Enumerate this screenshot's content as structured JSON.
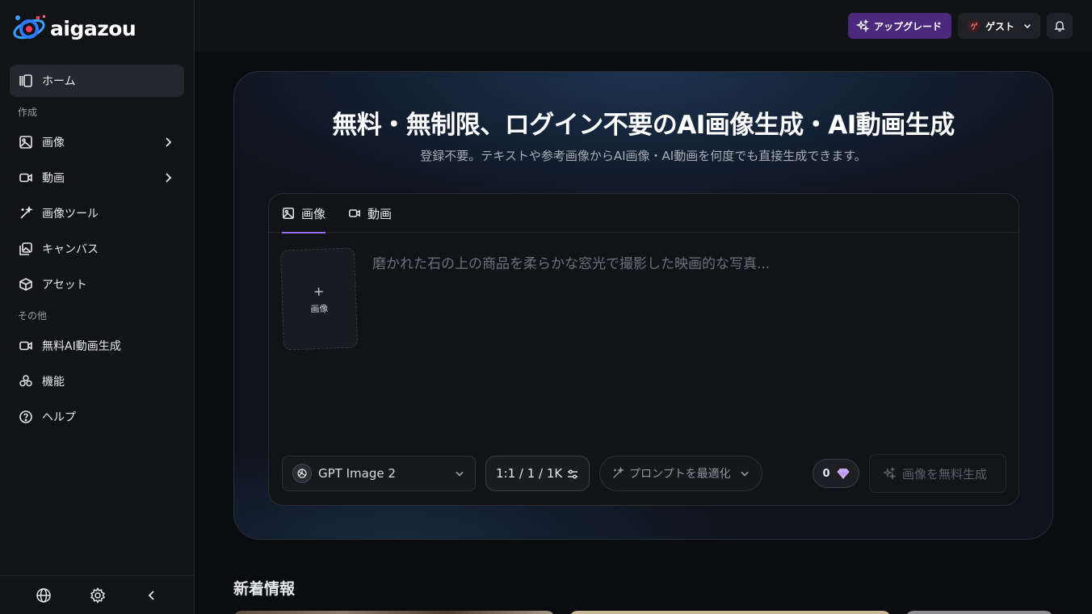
{
  "brand": {
    "name": "aigazou"
  },
  "sidebar": {
    "home": "ホーム",
    "section_create": "作成",
    "create_items": [
      {
        "label": "画像",
        "icon": "image-icon",
        "has_submenu": true
      },
      {
        "label": "動画",
        "icon": "video-icon",
        "has_submenu": true
      },
      {
        "label": "画像ツール",
        "icon": "magic-wand-icon",
        "has_submenu": false
      },
      {
        "label": "キャンバス",
        "icon": "canvas-icon",
        "has_submenu": false
      },
      {
        "label": "アセット",
        "icon": "cube-icon",
        "has_submenu": false
      }
    ],
    "section_other": "その他",
    "other_items": [
      {
        "label": "無料AI動画生成",
        "icon": "video-icon"
      },
      {
        "label": "機能",
        "icon": "features-icon"
      },
      {
        "label": "ヘルプ",
        "icon": "help-icon"
      }
    ]
  },
  "header": {
    "upgrade_label": "アップグレード",
    "guest_avatar": "ゲ",
    "guest_label": "ゲスト"
  },
  "hero": {
    "title": "無料・無制限、ログイン不要のAI画像生成・AI動画生成",
    "subtitle": "登録不要。テキストや参考画像からAI画像・AI動画を何度でも直接生成できます。"
  },
  "composer": {
    "tabs": [
      {
        "label": "画像",
        "active": true
      },
      {
        "label": "動画",
        "active": false
      }
    ],
    "upload_label": "画像",
    "prompt_placeholder": "磨かれた石の上の商品を柔らかな窓光で撮影した映画的な写真...",
    "model": "GPT Image 2",
    "ratio": "1:1 / 1 / 1K",
    "optimize_label": "プロンプトを最適化",
    "credits": "0",
    "generate_label": "画像を無料生成"
  },
  "news": {
    "title": "新着情報"
  },
  "colors": {
    "accent": "#9b6bf0",
    "upgrade_bg": "#4b2a7e",
    "sidebar_bg": "#121317",
    "page_bg": "#0b0c0f"
  }
}
